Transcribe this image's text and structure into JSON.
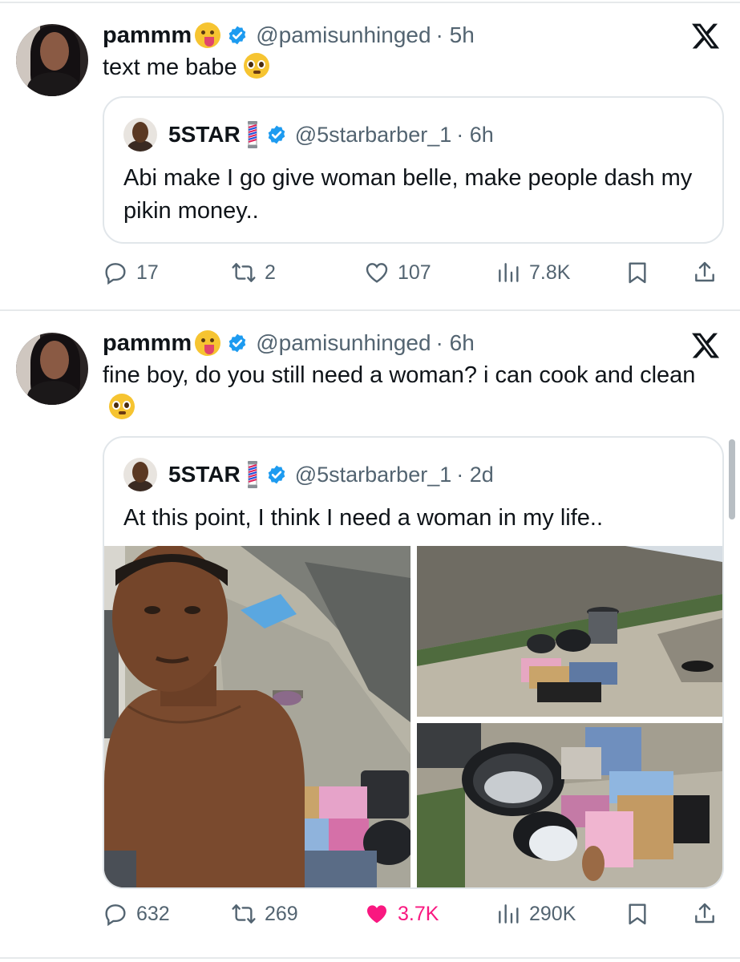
{
  "colors": {
    "accent": "#1d9bf0",
    "like": "#f91880",
    "secondary": "#536471"
  },
  "posts": [
    {
      "author": {
        "name": "pammm",
        "handle": "@pamisunhinged",
        "time": "· 5h",
        "name_emoji": "face-with-tongue"
      },
      "text": "text me babe",
      "text_emoji": "pleading-face",
      "quote": {
        "author": {
          "name": "5STAR",
          "handle": "@5starbarber_1",
          "time": "· 6h",
          "name_emoji": "barber-pole"
        },
        "text": "Abi make I go give woman belle, make people dash my pikin money.."
      },
      "actions": {
        "replies": "17",
        "reposts": "2",
        "likes": "107",
        "views": "7.8K",
        "liked": false
      }
    },
    {
      "author": {
        "name": "pammm",
        "handle": "@pamisunhinged",
        "time": "· 6h",
        "name_emoji": "face-with-tongue"
      },
      "text": "fine boy, do you still need a woman? i can cook and clean",
      "text_emoji": "pleading-face",
      "quote": {
        "author": {
          "name": "5STAR",
          "handle": "@5starbarber_1",
          "time": "· 2d",
          "name_emoji": "barber-pole"
        },
        "text": "At this point, I think I need a woman in my life..",
        "photos": [
          "selfie-shirtless-man",
          "yard-with-laundry",
          "buckets-and-clothes"
        ]
      },
      "actions": {
        "replies": "632",
        "reposts": "269",
        "likes": "3.7K",
        "views": "290K",
        "liked": true
      }
    }
  ]
}
